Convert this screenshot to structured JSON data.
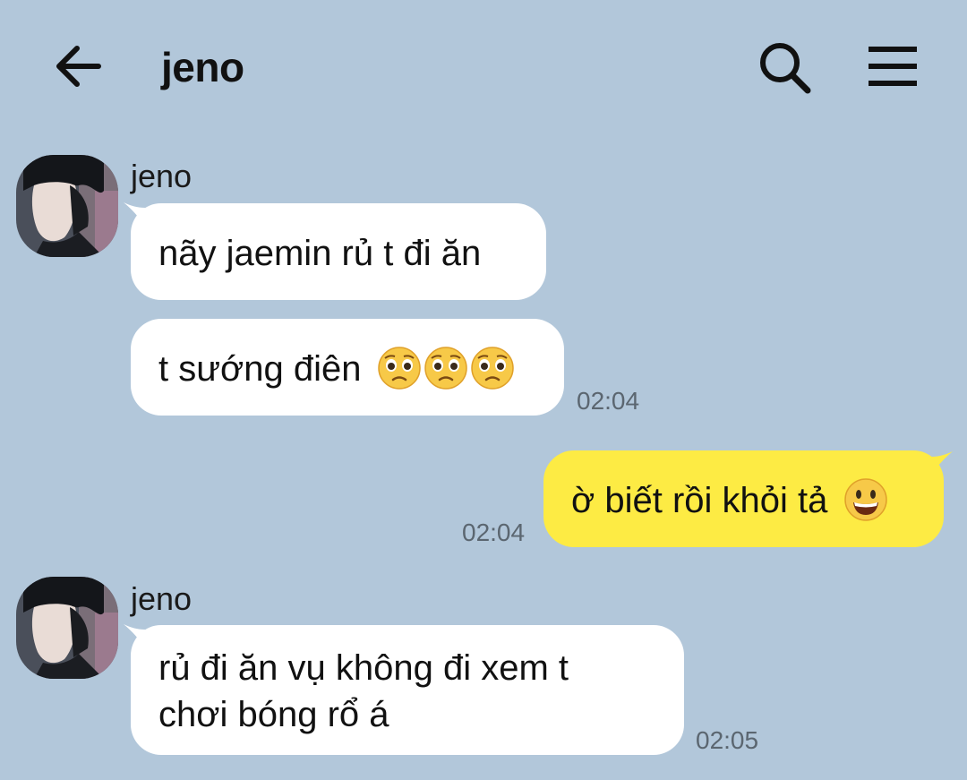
{
  "header": {
    "title": "jeno",
    "back_icon": "arrow-left-icon",
    "search_icon": "search-icon",
    "menu_icon": "hamburger-menu-icon"
  },
  "colors": {
    "background": "#b2c7da",
    "incoming_bubble": "#ffffff",
    "outgoing_bubble": "#fdeb44"
  },
  "messages": [
    {
      "sender": "jeno",
      "text": "nãy jaemin rủ t đi ăn"
    },
    {
      "text": "t sướng điên",
      "emoji": "pleading-face-icon",
      "emoji_count": 3,
      "time": "02:04"
    },
    {
      "text": "ờ biết rồi khỏi tả",
      "emoji": "grinning-face-icon",
      "time": "02:04"
    },
    {
      "sender": "jeno",
      "line1": "rủ đi ăn vụ không đi xem t",
      "line2": "chơi bóng rổ á",
      "time": "02:05"
    }
  ]
}
